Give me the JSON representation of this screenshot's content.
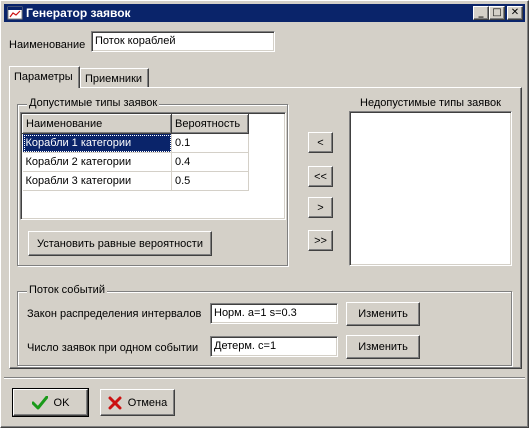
{
  "window": {
    "title": "Генератор заявок",
    "controls": {
      "minimize": "_",
      "maximize": "□",
      "close": "✕"
    }
  },
  "name_field": {
    "label": "Наименование",
    "value": "Поток кораблей"
  },
  "tabs": [
    {
      "label": "Параметры",
      "active": true
    },
    {
      "label": "Приемники",
      "active": false
    }
  ],
  "allowed_types": {
    "title": "Допустимые типы заявок",
    "columns": [
      "Наименование",
      "Вероятность"
    ],
    "rows": [
      {
        "name": "Корабли 1 категории",
        "probability": "0.1"
      },
      {
        "name": "Корабли 2 категории",
        "probability": "0.4"
      },
      {
        "name": "Корабли 3 категории",
        "probability": "0.5"
      }
    ],
    "equal_button": "Установить равные вероятности"
  },
  "transfer_buttons": [
    "<",
    "<<",
    ">",
    ">>"
  ],
  "disallowed_types": {
    "title": "Недопустимые типы заявок"
  },
  "event_flow": {
    "title": "Поток событий",
    "interval_law": {
      "label": "Закон распределения интервалов",
      "value": "Норм. a=1 s=0.3",
      "button": "Изменить"
    },
    "count_per_event": {
      "label": "Число заявок при одном событии",
      "value": "Детерм. c=1",
      "button": "Изменить"
    }
  },
  "footer": {
    "ok": "OK",
    "cancel": "Отмена"
  },
  "colors": {
    "face": "#d4d0c8",
    "title_bar": "#0a246a",
    "selection": "#0a246a",
    "ok_icon": "#1a9a1a",
    "cancel_icon": "#cc1111"
  },
  "icons": {
    "title": "app-window-icon",
    "ok": "checkmark-icon",
    "cancel": "x-mark-icon"
  }
}
